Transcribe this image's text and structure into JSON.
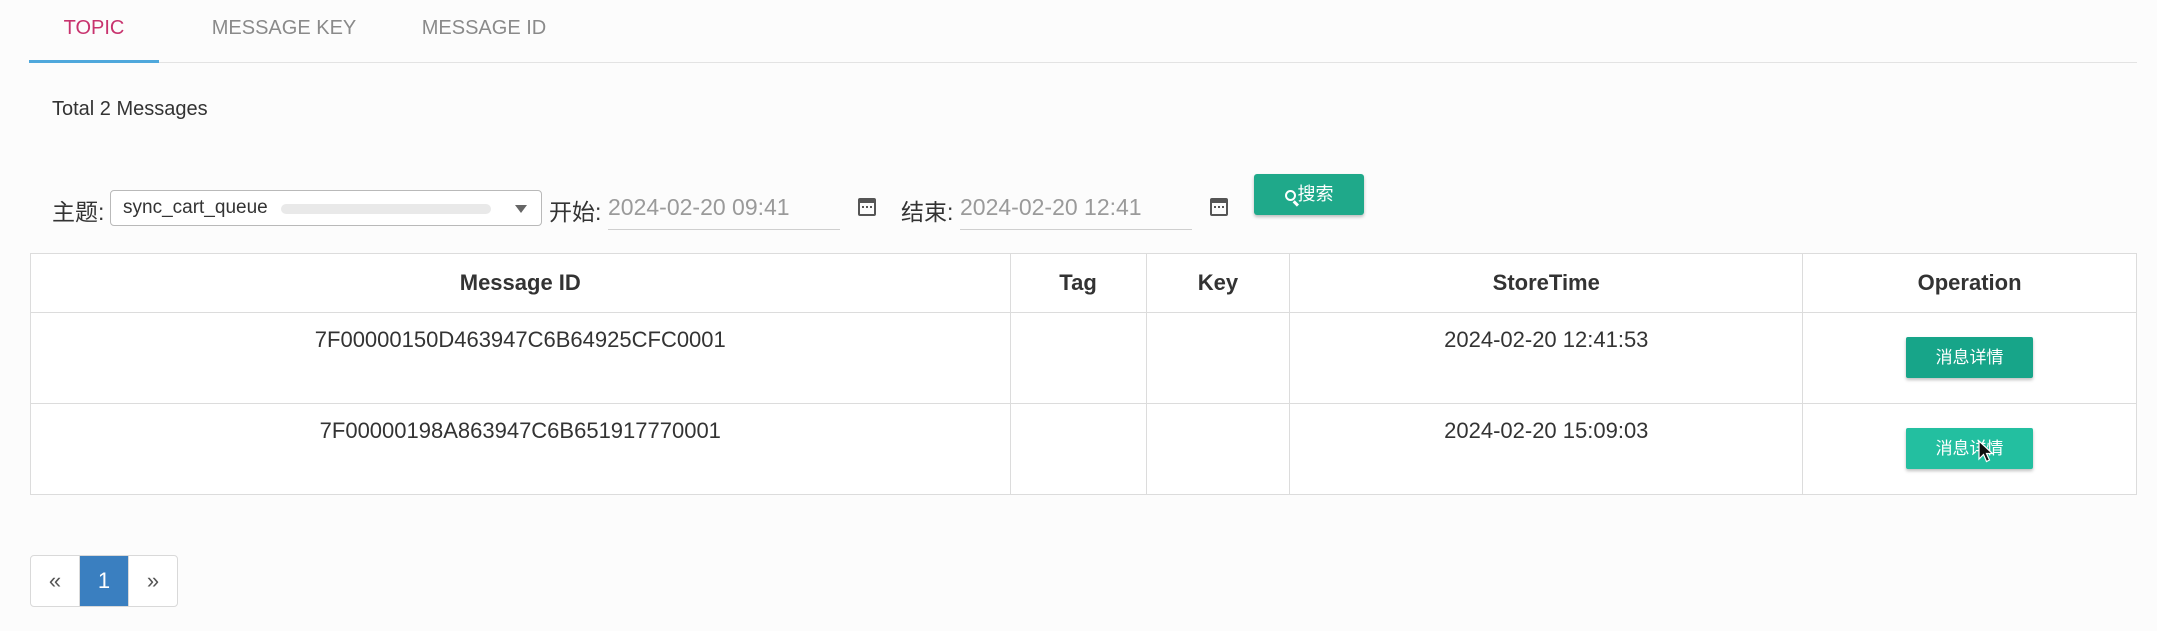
{
  "tabs": [
    {
      "label": "TOPIC",
      "active": true
    },
    {
      "label": "MESSAGE KEY",
      "active": false
    },
    {
      "label": "MESSAGE ID",
      "active": false
    }
  ],
  "summary": "Total 2 Messages",
  "filter": {
    "topic_label": "主题:",
    "topic_value": "sync_cart_queue",
    "start_label": "开始:",
    "start_value": "2024-02-20 09:41",
    "end_label": "结束:",
    "end_value": "2024-02-20 12:41",
    "search_label": "搜索"
  },
  "table": {
    "headers": [
      "Message ID",
      "Tag",
      "Key",
      "StoreTime",
      "Operation"
    ],
    "rows": [
      {
        "message_id": "7F00000150D463947C6B64925CFC0001",
        "tag": "",
        "key": "",
        "store_time": "2024-02-20 12:41:53",
        "action": "消息详情"
      },
      {
        "message_id": "7F00000198A863947C6B651917770001",
        "tag": "",
        "key": "",
        "store_time": "2024-02-20 15:09:03",
        "action": "消息详情"
      }
    ]
  },
  "pagination": {
    "prev": "«",
    "current": "1",
    "next": "»"
  },
  "icons": [
    "search-icon",
    "calendar-icon",
    "chevron-down-icon",
    "mouse-cursor"
  ],
  "colors": {
    "accent_tab": "#c8336e",
    "tab_underline": "#4fa8dc",
    "button_green": "#17a589",
    "page_active": "#3a7fc0"
  }
}
